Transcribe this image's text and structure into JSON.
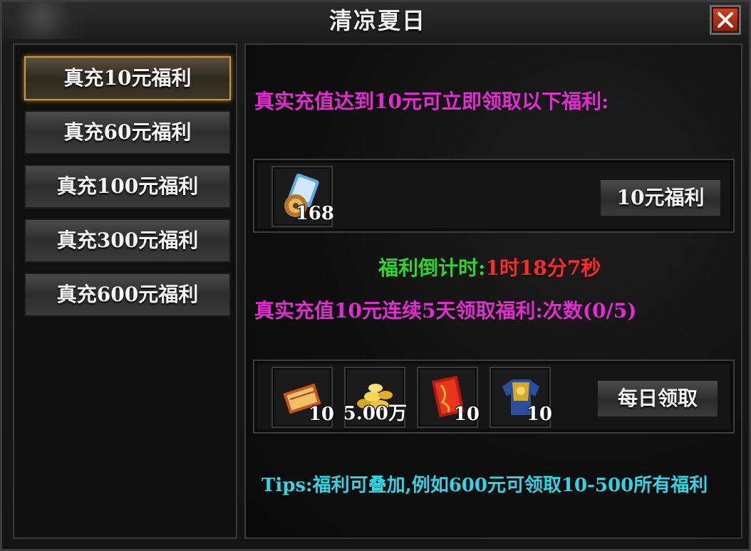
{
  "window": {
    "title": "清凉夏日",
    "close_label": "✕"
  },
  "sidebar": {
    "items": [
      {
        "label": "真充10元福利",
        "active": true
      },
      {
        "label": "真充60元福利",
        "active": false
      },
      {
        "label": "真充100元福利",
        "active": false
      },
      {
        "label": "真充300元福利",
        "active": false
      },
      {
        "label": "真充600元福利",
        "active": false
      }
    ]
  },
  "main": {
    "intro": "真实充值达到10元可立即领取以下福利:",
    "first_reward": {
      "items": [
        {
          "icon": "scroll-icon",
          "qty": "168"
        }
      ],
      "button": "10元福利"
    },
    "countdown_label": "福利倒计时:",
    "countdown_value": "1时18分7秒",
    "daily_text": "真实充值10元连续5天领取福利:次数(0/5)",
    "daily_reward": {
      "items": [
        {
          "icon": "gold-book-icon",
          "qty": "10"
        },
        {
          "icon": "gold-coins-icon",
          "qty": "5.00万"
        },
        {
          "icon": "red-talisman-icon",
          "qty": "10"
        },
        {
          "icon": "armor-icon",
          "qty": "10"
        }
      ],
      "button": "每日领取"
    },
    "tips": "Tips:福利可叠加,例如600元可领取10-500所有福利"
  },
  "colors": {
    "magenta": "#e62bd6",
    "green": "#2bd92b",
    "red": "#ff2a2a",
    "cyan": "#2fd6e6",
    "active_border": "#c89a3a",
    "close_red": "#c0391b"
  }
}
